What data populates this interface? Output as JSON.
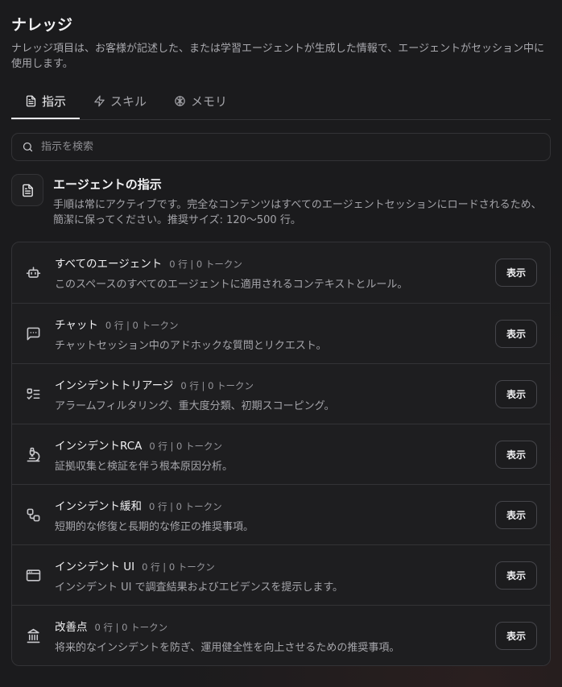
{
  "header": {
    "title": "ナレッジ",
    "description": "ナレッジ項目は、お客様が記述した、または学習エージェントが生成した情報で、エージェントがセッション中に使用します。"
  },
  "tabs": [
    {
      "label": "指示",
      "icon": "document-icon",
      "active": true
    },
    {
      "label": "スキル",
      "icon": "lightning-icon",
      "active": false
    },
    {
      "label": "メモリ",
      "icon": "brain-icon",
      "active": false
    }
  ],
  "search": {
    "placeholder": "指示を検索",
    "value": ""
  },
  "section": {
    "title": "エージェントの指示",
    "description": "手順は常にアクティブです。完全なコンテンツはすべてのエージェントセッションにロードされるため、簡潔に保ってください。推奨サイズ: 120〜500 行。"
  },
  "items": [
    {
      "name": "すべてのエージェント",
      "meta": "0 行 | 0 トークン",
      "desc": "このスペースのすべてのエージェントに適用されるコンテキストとルール。",
      "icon": "robot-icon",
      "button": "表示"
    },
    {
      "name": "チャット",
      "meta": "0 行 | 0 トークン",
      "desc": "チャットセッション中のアドホックな質問とリクエスト。",
      "icon": "chat-icon",
      "button": "表示"
    },
    {
      "name": "インシデントトリアージ",
      "meta": "0 行 | 0 トークン",
      "desc": "アラームフィルタリング、重大度分類、初期スコーピング。",
      "icon": "checklist-icon",
      "button": "表示"
    },
    {
      "name": "インシデントRCA",
      "meta": "0 行 | 0 トークン",
      "desc": "証拠収集と検証を伴う根本原因分析。",
      "icon": "microscope-icon",
      "button": "表示"
    },
    {
      "name": "インシデント緩和",
      "meta": "0 行 | 0 トークン",
      "desc": "短期的な修復と長期的な修正の推奨事項。",
      "icon": "workflow-icon",
      "button": "表示"
    },
    {
      "name": "インシデント UI",
      "meta": "0 行 | 0 トークン",
      "desc": "インシデント UI で調査結果およびエビデンスを提示します。",
      "icon": "browser-window-icon",
      "button": "表示"
    },
    {
      "name": "改善点",
      "meta": "0 行 | 0 トークン",
      "desc": "将来的なインシデントを防ぎ、運用健全性を向上させるための推奨事項。",
      "icon": "landmark-icon",
      "button": "表示"
    }
  ]
}
